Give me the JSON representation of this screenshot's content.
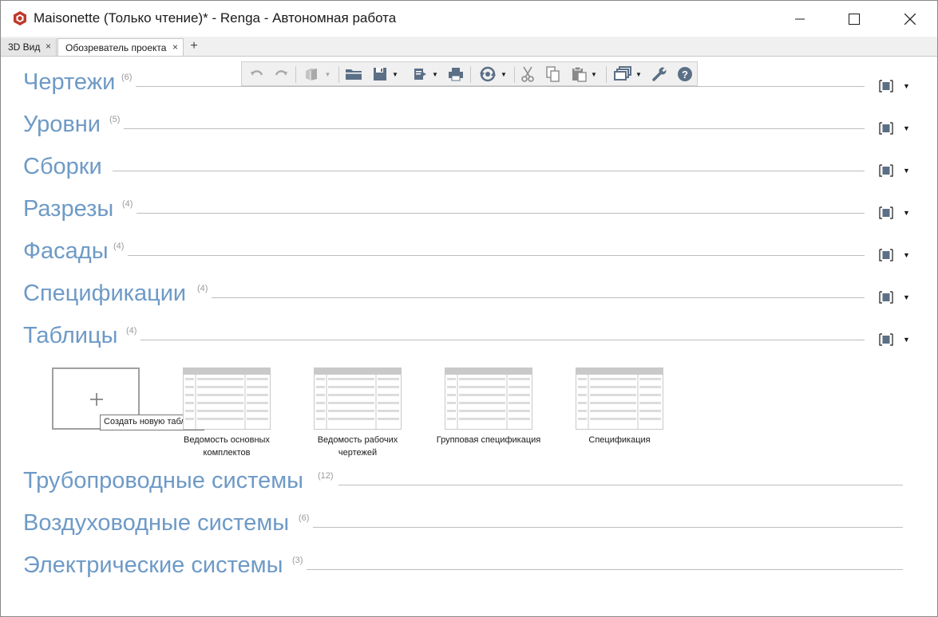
{
  "window": {
    "title": "Maisonette (Только чтение)* - Renga - Автономная работа"
  },
  "tabs": [
    {
      "label": "3D Вид",
      "close": "×"
    },
    {
      "label": "Обозреватель проекта",
      "close": "×"
    }
  ],
  "tab_add": "+",
  "toolbar": {
    "icons": [
      "undo-icon",
      "redo-icon",
      "3d-box-icon",
      "open-folder-icon",
      "save-icon",
      "export-icon",
      "print-icon",
      "sync-icon",
      "cut-icon",
      "copy-icon",
      "paste-icon",
      "views-icon",
      "settings-wrench-icon",
      "help-icon"
    ]
  },
  "sections": [
    {
      "title": "Чертежи",
      "count": "(6)"
    },
    {
      "title": "Уровни",
      "count": "(5)"
    },
    {
      "title": "Сборки",
      "count": ""
    },
    {
      "title": "Разрезы",
      "count": "(4)"
    },
    {
      "title": "Фасады",
      "count": "(4)"
    },
    {
      "title": "Спецификации",
      "count": "(4)"
    },
    {
      "title": "Таблицы",
      "count": "(4)"
    },
    {
      "title": "Трубопроводные системы",
      "count": "(12)"
    },
    {
      "title": "Воздуховодные системы",
      "count": "(6)"
    },
    {
      "title": "Электрические системы",
      "count": "(3)"
    }
  ],
  "tables": {
    "new_tooltip": "Создать новую таблицу",
    "items": [
      {
        "name_line1": "Ведомость основных",
        "name_line2": "комплектов"
      },
      {
        "name_line1": "Ведомость рабочих",
        "name_line2": "чертежей"
      },
      {
        "name_line1": "Групповая спецификация",
        "name_line2": ""
      },
      {
        "name_line1": "Спецификация",
        "name_line2": ""
      }
    ]
  },
  "colors": {
    "section_title": "#6e9ac6",
    "accent_icon": "#5b6f86"
  }
}
